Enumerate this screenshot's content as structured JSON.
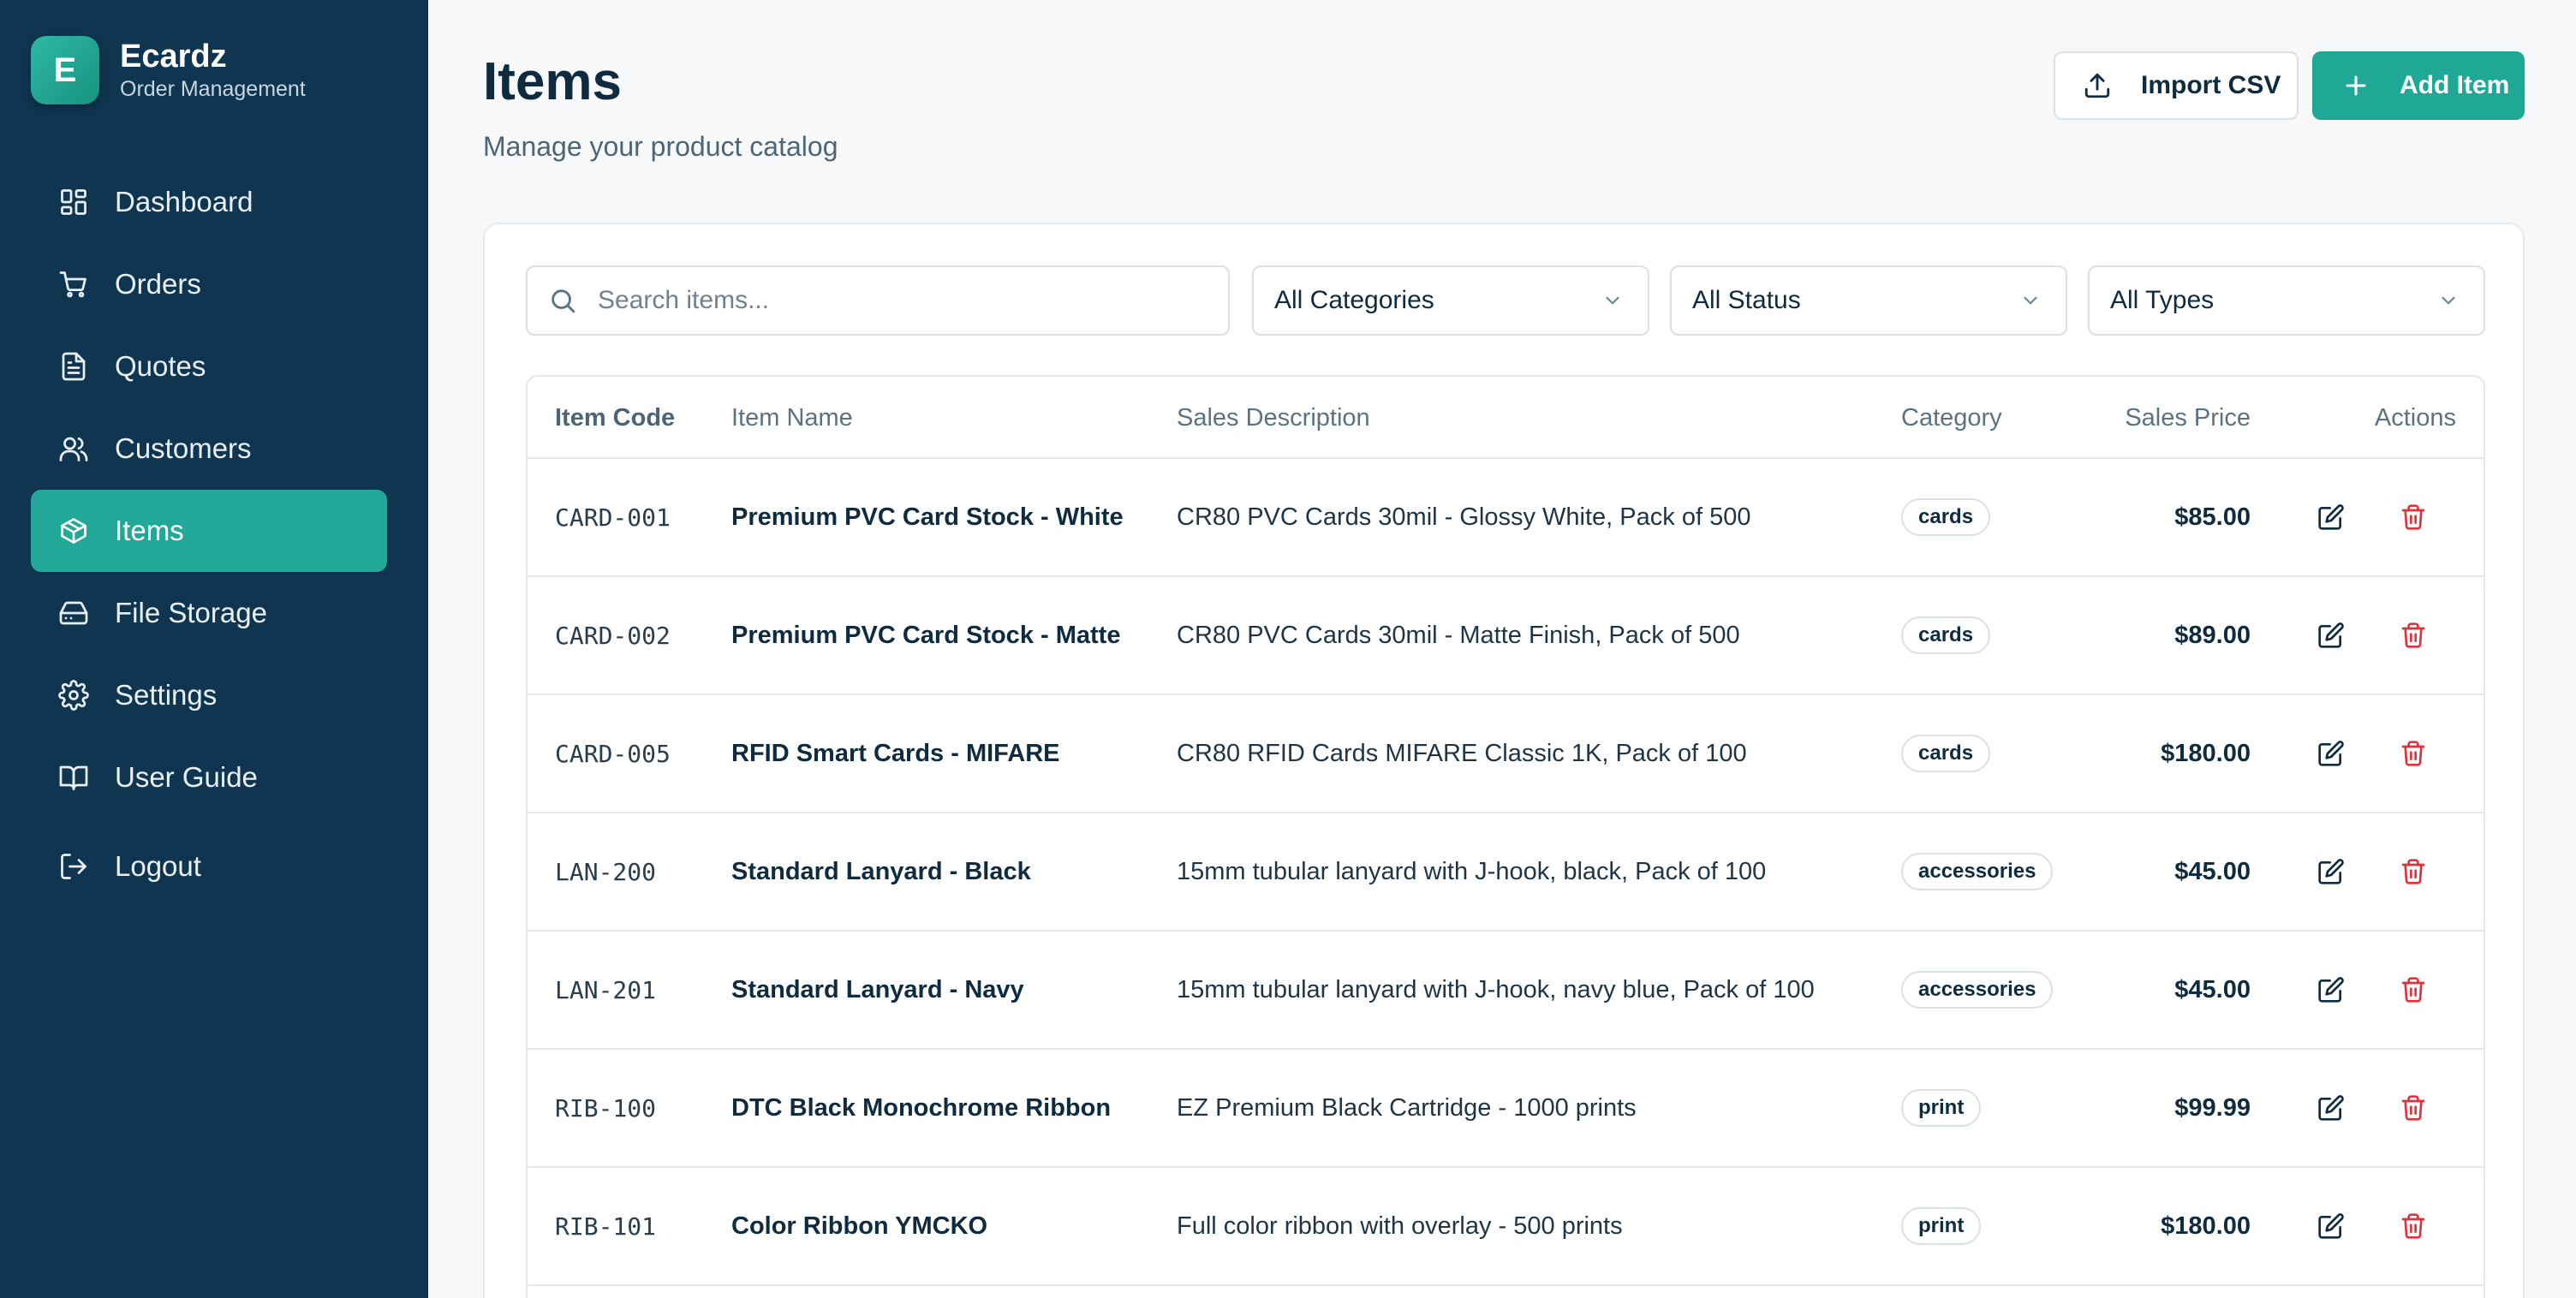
{
  "brand": {
    "logo_letter": "E",
    "name": "Ecardz",
    "subtitle": "Order Management"
  },
  "sidebar": {
    "items": [
      {
        "label": "Dashboard",
        "icon": "dashboard-icon",
        "active": false
      },
      {
        "label": "Orders",
        "icon": "cart-icon",
        "active": false
      },
      {
        "label": "Quotes",
        "icon": "document-icon",
        "active": false
      },
      {
        "label": "Customers",
        "icon": "users-icon",
        "active": false
      },
      {
        "label": "Items",
        "icon": "package-icon",
        "active": true
      },
      {
        "label": "File Storage",
        "icon": "hard-drive-icon",
        "active": false
      },
      {
        "label": "Settings",
        "icon": "gear-icon",
        "active": false
      },
      {
        "label": "User Guide",
        "icon": "book-icon",
        "active": false
      }
    ],
    "logout": {
      "label": "Logout",
      "icon": "logout-icon"
    }
  },
  "header": {
    "title": "Items",
    "subtitle": "Manage your product catalog",
    "import_label": "Import CSV",
    "add_label": "Add Item"
  },
  "filters": {
    "search_placeholder": "Search items...",
    "category": "All Categories",
    "status": "All Status",
    "type": "All Types"
  },
  "table": {
    "columns": [
      "Item Code",
      "Item Name",
      "Sales Description",
      "Category",
      "Sales Price",
      "Actions"
    ],
    "rows": [
      {
        "code": "CARD-001",
        "name": "Premium PVC Card Stock - White",
        "description": "CR80 PVC Cards 30mil - Glossy White, Pack of 500",
        "category": "cards",
        "price": "$85.00"
      },
      {
        "code": "CARD-002",
        "name": "Premium PVC Card Stock - Matte",
        "description": "CR80 PVC Cards 30mil - Matte Finish, Pack of 500",
        "category": "cards",
        "price": "$89.00"
      },
      {
        "code": "CARD-005",
        "name": "RFID Smart Cards - MIFARE",
        "description": "CR80 RFID Cards MIFARE Classic 1K, Pack of 100",
        "category": "cards",
        "price": "$180.00"
      },
      {
        "code": "LAN-200",
        "name": "Standard Lanyard - Black",
        "description": "15mm tubular lanyard with J-hook, black, Pack of 100",
        "category": "accessories",
        "price": "$45.00"
      },
      {
        "code": "LAN-201",
        "name": "Standard Lanyard - Navy",
        "description": "15mm tubular lanyard with J-hook, navy blue, Pack of 100",
        "category": "accessories",
        "price": "$45.00"
      },
      {
        "code": "RIB-100",
        "name": "DTC Black Monochrome Ribbon",
        "description": "EZ Premium Black Cartridge - 1000 prints",
        "category": "print",
        "price": "$99.99"
      },
      {
        "code": "RIB-101",
        "name": "Color Ribbon YMCKO",
        "description": "Full color ribbon with overlay - 500 prints",
        "category": "print",
        "price": "$180.00"
      }
    ]
  },
  "colors": {
    "sidebar_bg": "#0f3550",
    "accent": "#1fa896",
    "danger": "#e0323b",
    "text_primary": "#0f2b3f"
  }
}
